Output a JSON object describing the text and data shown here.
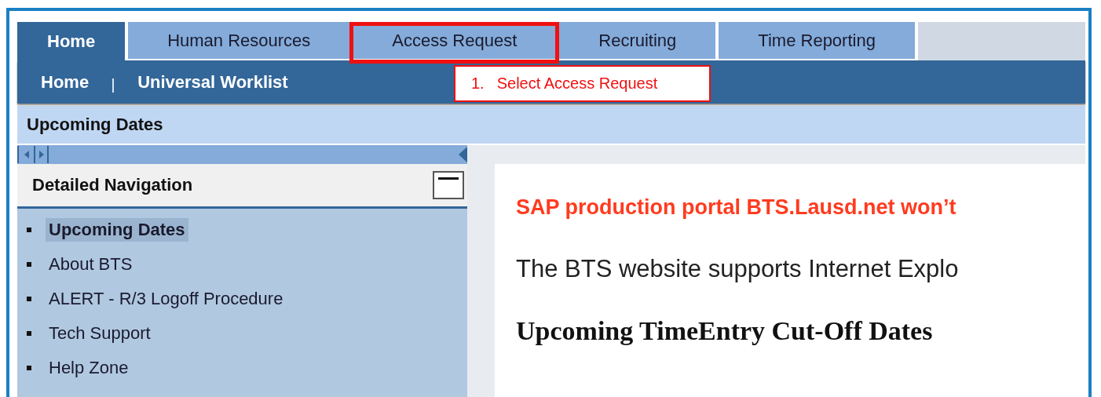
{
  "tabs": [
    {
      "label": "Home",
      "selected": true,
      "highlighted": false
    },
    {
      "label": "Human Resources",
      "selected": false,
      "highlighted": false
    },
    {
      "label": "Access Request",
      "selected": false,
      "highlighted": true
    },
    {
      "label": "Recruiting",
      "selected": false,
      "highlighted": false
    },
    {
      "label": "Time Reporting",
      "selected": false,
      "highlighted": false
    }
  ],
  "sub_nav": [
    {
      "label": "Home"
    },
    {
      "label": "Universal Worklist"
    }
  ],
  "annotation": {
    "step": "1.",
    "text": "Select Access Request"
  },
  "page_title": "Upcoming Dates",
  "detailed_navigation": {
    "title": "Detailed Navigation",
    "items": [
      {
        "label": "Upcoming Dates",
        "selected": true
      },
      {
        "label": "About BTS",
        "selected": false
      },
      {
        "label": "ALERT - R/3 Logoff Procedure",
        "selected": false
      },
      {
        "label": "Tech Support",
        "selected": false
      },
      {
        "label": "Help Zone",
        "selected": false
      }
    ]
  },
  "content": {
    "notice": "SAP production portal BTS.Lausd.net won’t",
    "browser_note": "The BTS website supports Internet Explo",
    "heading": "Upcoming TimeEntry Cut-Off Dates"
  }
}
